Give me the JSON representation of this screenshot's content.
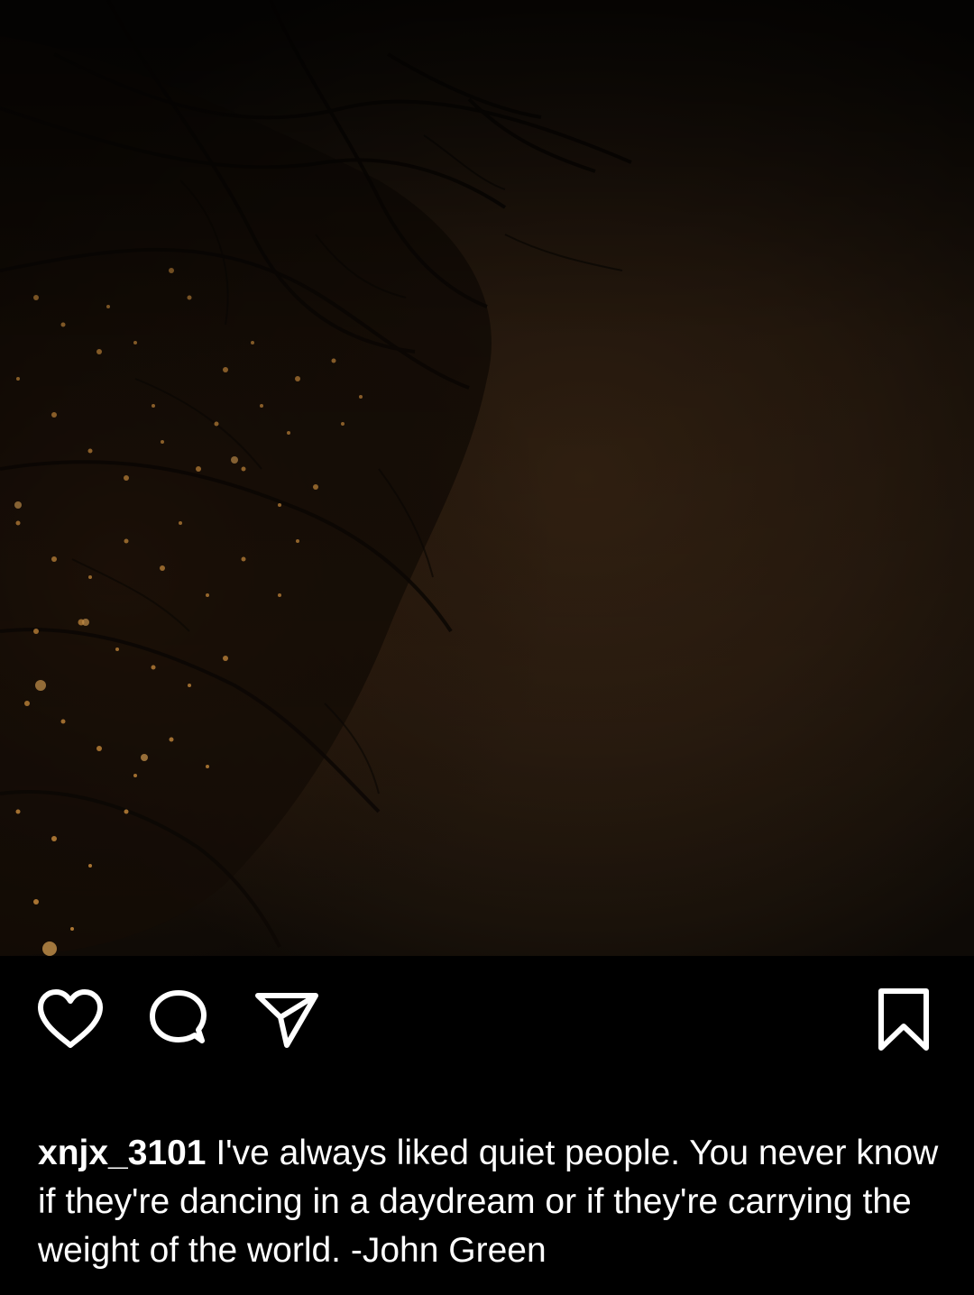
{
  "post": {
    "image_alt": "Night photo of a bare tree with orange-lit leaves against a hazy brown sky",
    "actions": {
      "like_icon": "heart-icon",
      "comment_icon": "speech-bubble-icon",
      "share_icon": "paper-plane-icon",
      "save_icon": "bookmark-icon"
    },
    "caption": {
      "username": "xnjx_3101",
      "text": "I've always liked quiet people. You never know if they're dancing in a daydream or if they're carrying the weight of the world. -John Green"
    }
  },
  "colors": {
    "background": "#000000",
    "text": "#ffffff",
    "sky": "#2c1d10",
    "leaf_light": "#c88a3c"
  }
}
